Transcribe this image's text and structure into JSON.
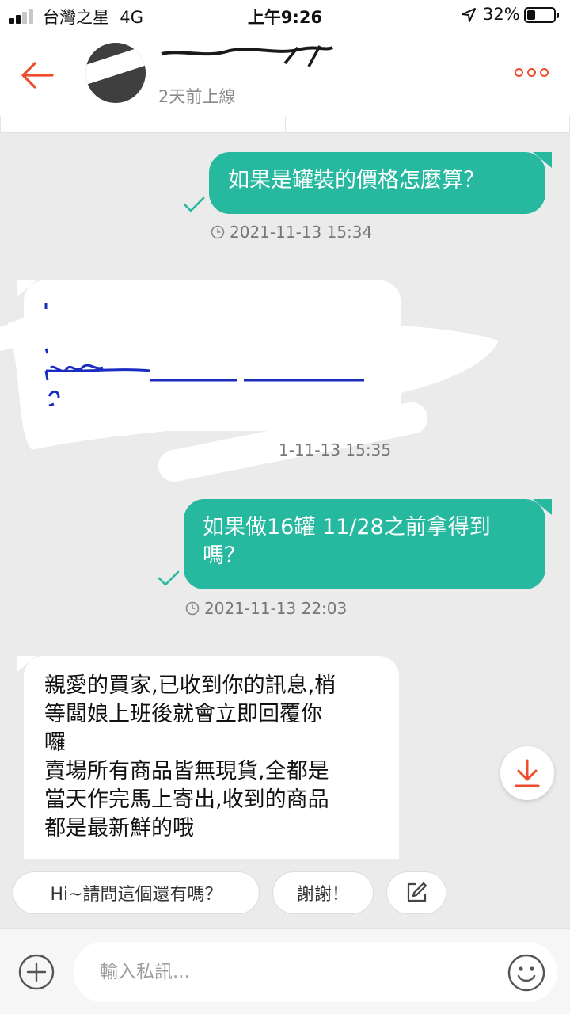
{
  "status_bar": {
    "carrier": "台灣之星",
    "network": "4G",
    "time": "上午9:26",
    "battery": "32%",
    "battery_level": 0.32
  },
  "header": {
    "last_online": "2天前上線",
    "icons": {
      "back": "arrow-left-icon",
      "more": "more-dots-icon"
    },
    "accent_color": "#ee4d2d"
  },
  "chat": {
    "messages": [
      {
        "direction": "outgoing",
        "text": "如果是罐裝的價格怎麼算？",
        "timestamp": "2021-11-13 15:34"
      },
      {
        "direction": "incoming",
        "text": "",
        "timestamp": "1-11-13 15:35"
      },
      {
        "direction": "outgoing",
        "text": "如果做16罐 11/28之前拿得到嗎？",
        "timestamp": "2021-11-13 22:03"
      },
      {
        "direction": "incoming",
        "lines": [
          "親愛的買家,已收到你的訊息,梢",
          "等闆娘上班後就會立即回覆你",
          "囉",
          "賣場所有商品皆無現貨,全都是",
          "當天作完馬上寄出,收到的商品",
          "都是最新鮮的哦"
        ]
      }
    ],
    "bubble_color": "#26b9a0"
  },
  "quick_replies": [
    {
      "label": "Hi~請問這個還有嗎？"
    },
    {
      "label": "謝謝！"
    }
  ],
  "composer": {
    "placeholder": "輸入私訊..."
  }
}
